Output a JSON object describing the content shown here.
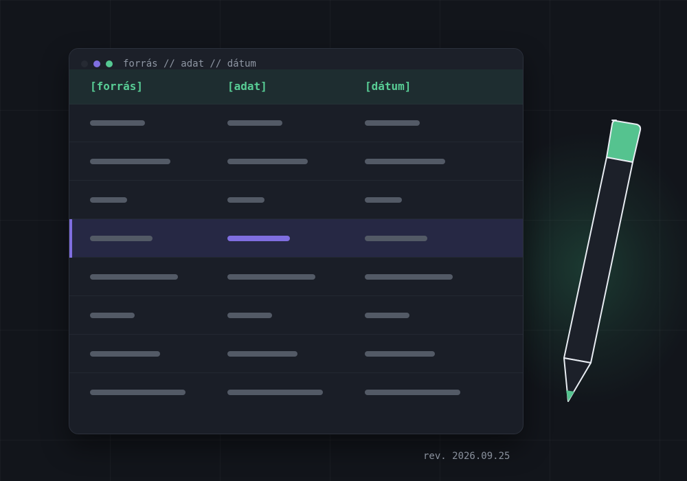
{
  "window": {
    "title": "forrás // adat // dátum"
  },
  "table": {
    "columns": [
      "[forrás]",
      "[adat]",
      "[dátum]"
    ],
    "rows": [
      {
        "selected": false
      },
      {
        "selected": false
      },
      {
        "selected": false
      },
      {
        "selected": true
      },
      {
        "selected": false
      },
      {
        "selected": false
      },
      {
        "selected": false
      },
      {
        "selected": false
      }
    ],
    "selected_row_index": 3
  },
  "footer": {
    "revision": "rev. 2026.09.25"
  },
  "icons": {
    "pencil": "pencil-icon",
    "window_controls": [
      "window-dot-icon",
      "window-dot-icon",
      "window-dot-icon"
    ]
  },
  "colors": {
    "background": "#12151b",
    "accent_green": "#58cd95",
    "accent_purple": "#7f6ee0",
    "placeholder_bar": "#535a66",
    "selected_row": "#262844"
  }
}
